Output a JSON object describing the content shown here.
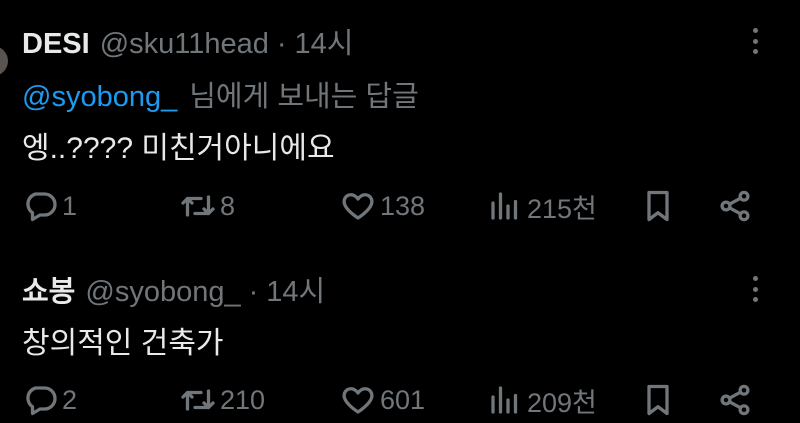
{
  "tweets": [
    {
      "display_name": "DESI",
      "handle": "@sku11head",
      "dot": "·",
      "time": "14시",
      "reply_mention": "@syobong_",
      "reply_text": "님에게 보내는 답글",
      "body": "엥..???? 미친거아니에요",
      "replies": "1",
      "retweets": "8",
      "likes": "138",
      "views": "215천"
    },
    {
      "display_name": "쇼봉",
      "handle": "@syobong_",
      "dot": "·",
      "time": "14시",
      "body": "창의적인 건축가",
      "replies": "2",
      "retweets": "210",
      "likes": "601",
      "views": "209천"
    }
  ],
  "icons": {
    "reply": "reply-icon",
    "retweet": "retweet-icon",
    "like": "heart-icon",
    "views": "views-icon",
    "bookmark": "bookmark-icon",
    "share": "share-icon",
    "more": "more-icon"
  },
  "colors": {
    "background": "#000000",
    "text": "#e7e9ea",
    "muted": "#71767b",
    "link": "#1d9bf0"
  }
}
